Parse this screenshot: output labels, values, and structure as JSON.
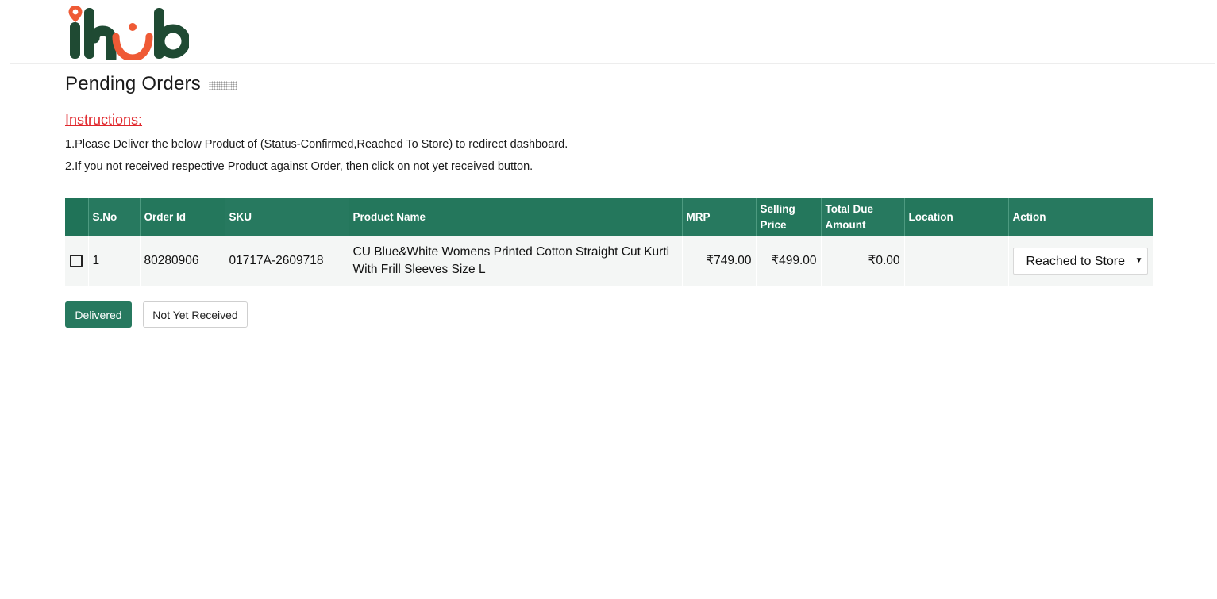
{
  "brand": {
    "logo_text": "ihub",
    "colors": {
      "dark_green": "#1f4a33",
      "accent_orange": "#ef5a35",
      "table_header": "#27795f",
      "instruction_red": "#e0262b"
    }
  },
  "page": {
    "title": "Pending Orders"
  },
  "instructions": {
    "heading": "Instructions:",
    "line1": "1.Please Deliver the below Product of (Status-Confirmed,Reached To Store) to redirect dashboard.",
    "line2": "2.If you not received respective Product against Order, then click on not yet received button."
  },
  "table": {
    "headers": [
      "",
      "S.No",
      "Order Id",
      "SKU",
      "Product Name",
      "MRP",
      "Selling Price",
      "Total Due Amount",
      "Location",
      "Action"
    ],
    "rows": [
      {
        "sno": "1",
        "order_id": "80280906",
        "sku": "01717A-2609718",
        "product_name": "CU Blue&White Womens Printed Cotton Straight Cut Kurti With Frill Sleeves Size L",
        "mrp": "₹749.00",
        "selling_price": "₹499.00",
        "total_due": "₹0.00",
        "location": "",
        "action_selected": "Reached to Store",
        "checked": false
      }
    ]
  },
  "buttons": {
    "delivered": "Delivered",
    "not_yet_received": "Not Yet Received"
  }
}
